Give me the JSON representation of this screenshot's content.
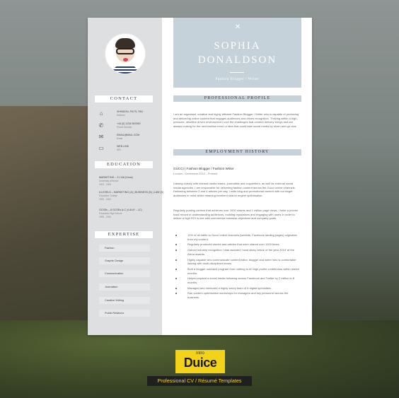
{
  "resume": {
    "name_first": "SOPHIA",
    "name_last": "DONALDSON",
    "role": "Fashion Blogger / Writer",
    "contact_heading": "CONTACT",
    "contact": [
      {
        "icon": "house-icon",
        "value": "SHINDON, PILTS, SN1",
        "label": "Address"
      },
      {
        "icon": "phone-icon",
        "value": "+44 (0) 1234 567890",
        "label": "Phone Number"
      },
      {
        "icon": "email-icon",
        "value": "EMAIL@MAIL.COM",
        "label": "Email"
      },
      {
        "icon": "monitor-icon",
        "value": "WEB LINK",
        "label": "URL"
      }
    ],
    "education_heading": "EDUCATION",
    "education": [
      {
        "title": "MARKETING – 2:1 BA (Hons)",
        "school": "University of Bristol",
        "years": "2002 - 2005"
      },
      {
        "title": "A LEVELS – MARKETING (A) | BUSINESS (B) | LAW (D)",
        "school": "Education College",
        "years": "2000 - 2002"
      },
      {
        "title": "GCSEs – 8 GCSEs A-C (4 At A* – 1C)",
        "school": "Education High School",
        "years": "1995 - 2000"
      }
    ],
    "expertise_heading": "EXPERTISE",
    "expertise": [
      "Fashion",
      "Graphic Design",
      "Communication",
      "Journalism",
      "Creative Writing",
      "Public Relations"
    ],
    "profile_heading": "PROFESSIONAL PROFILE",
    "profile_text": "I am an organised, creative and highly efficient Fashion Blogger / Writer who is capable of producing and delivering online content that engages audiences and drives recognition. Thriving within a high-pressure, deadline driven environment I love the challenges that content delivery brings and am always looking for the next fashion trend or idea that could take social media by storm and go viral.",
    "history_heading": "EMPLOYMENT HISTORY",
    "job_title": "GUCCI | Fashion Blogger / Fashion Writer",
    "job_meta": "London / December 2012 - Present",
    "job_para1": "Liaising closely with internal media teams, journalists and copywriters, as well as external social media agencies, I am responsible for delivering fashion content across the Gucci online channels. Delivering between 3 and 4 articles per day, I write blog and promotional content with our target audiences in mind whilst retaining excellent search engine optimisation.",
    "job_para2": "Regularly posting content that achieves over 1000 shares and 1 million page views, I have a proven track record in understanding audiences, building reputations and engaging with users in order to deliver a high ROI in line with commercial business objectives and company goals.",
    "bullets": [
      "12% of all traffic to Gucci online channels (website, Facebook landing pages) originates from my content.",
      "Regularly produced stories and articles that were shared over 1000 times.",
      "Gained industry recognition I was awarded 'most sticky article of the year 2015' at the Aleva awards.",
      "Highly capable who communicate content editor, blogger and writer who is comfortable liaising with multi-disciplined teams.",
      "Built a blogger outreach program from nothing to 60 high profile contributors within twelve months.",
      "Helped expand a social media following across Facebook and Twitter by 2 million in 8 months.",
      "Managed and mentored a highly savvy team of 6 digital specialists.",
      "Ran content optimisation workshops for managers and key personnel across the business."
    ]
  },
  "brand": {
    "small": "intro",
    "big": "Duice",
    "tagline": "Professional CV / Résumé Templates"
  }
}
